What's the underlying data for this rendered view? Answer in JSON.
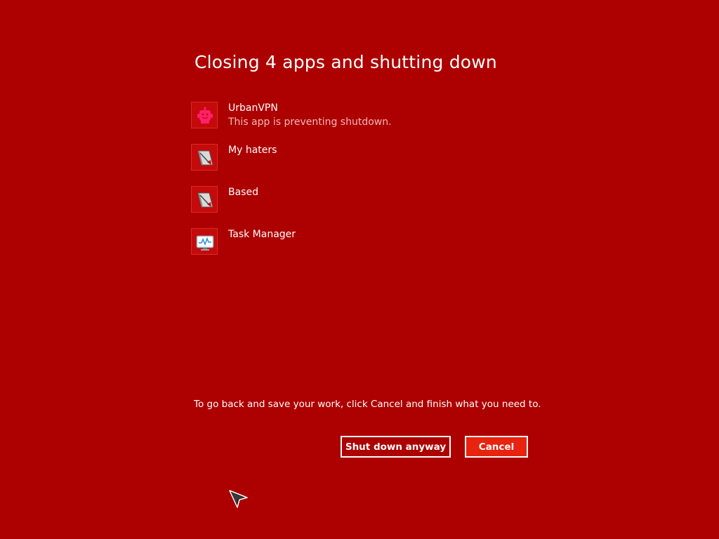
{
  "dialog": {
    "title": "Closing 4 apps and shutting down",
    "apps": [
      {
        "name": "UrbanVPN",
        "status": "This app is preventing shutdown.",
        "icon": "robot-icon"
      },
      {
        "name": "My haters",
        "status": "",
        "icon": "generic-app-icon"
      },
      {
        "name": "Based",
        "status": "",
        "icon": "generic-app-icon"
      },
      {
        "name": "Task Manager",
        "status": "",
        "icon": "task-manager-icon"
      }
    ],
    "instructions": "To go back and save your work, click Cancel and finish what you need to.",
    "buttons": {
      "shutdown_label": "Shut down anyway",
      "cancel_label": "Cancel"
    }
  },
  "colors": {
    "background": "#ad0000",
    "text": "#ffffff",
    "status_text": "#f2b8b8",
    "cancel_accent": "#e8230f",
    "urbanvpn_icon": "#ff1f6b"
  }
}
